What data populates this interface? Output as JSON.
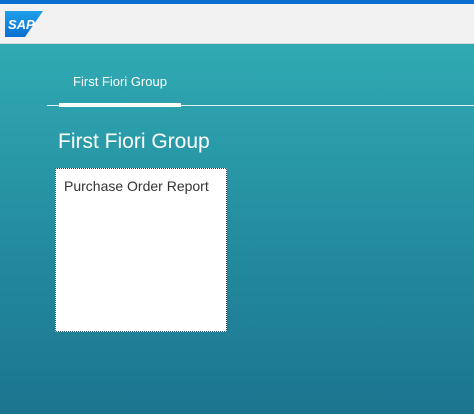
{
  "header": {
    "logo_text": "SAP",
    "logo_color": "#0a6ed1"
  },
  "anchor_bar": {
    "tabs": [
      {
        "label": "First Fiori Group",
        "selected": true
      }
    ]
  },
  "group": {
    "title": "First Fiori Group",
    "tiles": [
      {
        "title": "Purchase Order Report"
      }
    ]
  },
  "colors": {
    "shell_background_top": "#30aab3",
    "shell_background_bottom": "#1b7590",
    "header_background": "#f2f2f2"
  }
}
